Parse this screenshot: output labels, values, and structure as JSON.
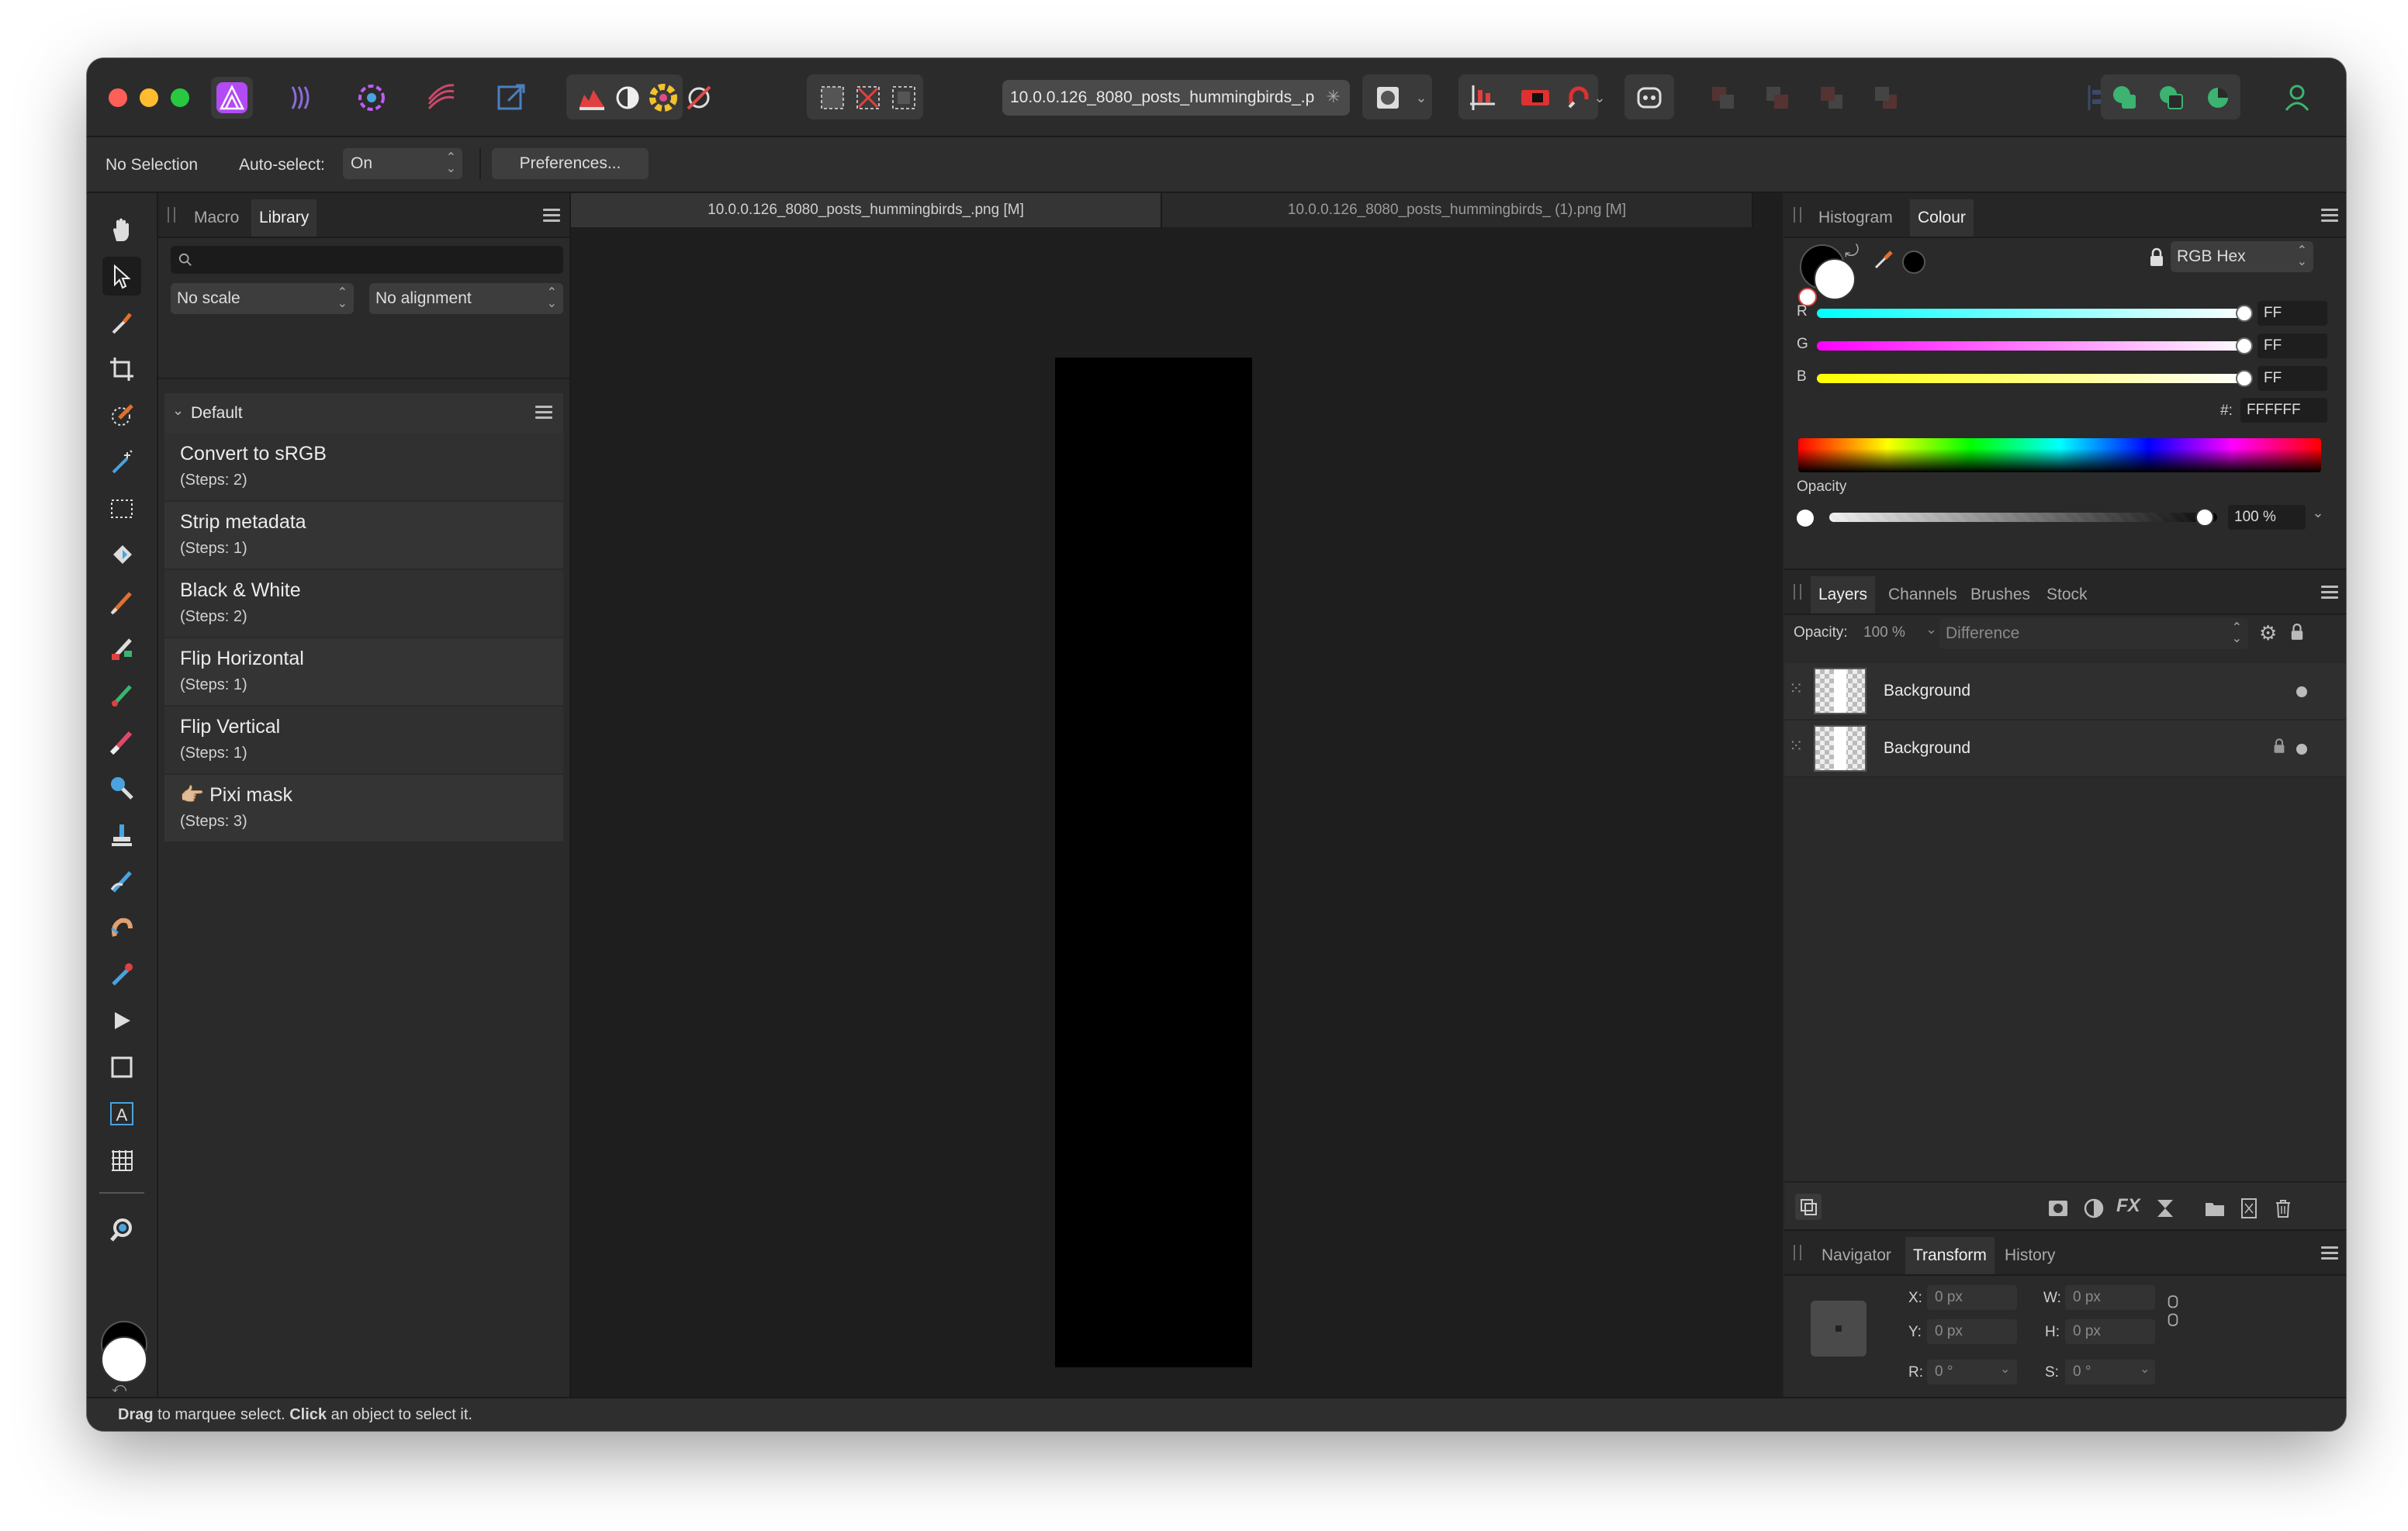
{
  "document_tab_title": "10.0.0.126_8080_posts_hummingbirds_.p",
  "context_toolbar": {
    "selection_status": "No Selection",
    "auto_select_label": "Auto-select:",
    "auto_select_value": "On",
    "preferences_button": "Preferences..."
  },
  "left_panel": {
    "tabs": [
      "Macro",
      "Library"
    ],
    "active_tab": "Library",
    "scale_select": "No scale",
    "alignment_select": "No alignment",
    "group_name": "Default",
    "macros": [
      {
        "name": "Convert to sRGB",
        "steps": "(Steps: 2)"
      },
      {
        "name": "Strip metadata",
        "steps": "(Steps: 1)"
      },
      {
        "name": "Black & White",
        "steps": "(Steps: 2)"
      },
      {
        "name": "Flip Horizontal",
        "steps": "(Steps: 1)"
      },
      {
        "name": "Flip Vertical",
        "steps": "(Steps: 1)"
      },
      {
        "name": "Pixi mask",
        "steps": "(Steps: 3)",
        "emoji": "👉🏼"
      }
    ]
  },
  "document_tabs": [
    {
      "title": "10.0.0.126_8080_posts_hummingbirds_.png [M]",
      "active": true
    },
    {
      "title": "10.0.0.126_8080_posts_hummingbirds_ (1).png [M]",
      "active": false
    }
  ],
  "colour_panel": {
    "tabs": [
      "Histogram",
      "Colour"
    ],
    "active_tab": "Colour",
    "mode": "RGB Hex",
    "channels": [
      {
        "label": "R",
        "value": "FF",
        "level": 1.0
      },
      {
        "label": "G",
        "value": "FF",
        "level": 1.0
      },
      {
        "label": "B",
        "value": "FF",
        "level": 1.0
      }
    ],
    "hex_label": "#:",
    "hex_value": "FFFFFF",
    "opacity_label": "Opacity",
    "opacity_value": "100 %"
  },
  "layers_panel": {
    "tabs": [
      "Layers",
      "Channels",
      "Brushes",
      "Stock"
    ],
    "active_tab": "Layers",
    "opacity_label": "Opacity:",
    "opacity_value": "100 %",
    "blend_mode": "Difference",
    "layers": [
      {
        "name": "Background",
        "locked": false
      },
      {
        "name": "Background",
        "locked": true
      }
    ]
  },
  "transform_panel": {
    "tabs": [
      "Navigator",
      "Transform",
      "History"
    ],
    "active_tab": "Transform",
    "x_label": "X:",
    "x_value": "0 px",
    "y_label": "Y:",
    "y_value": "0 px",
    "w_label": "W:",
    "w_value": "0 px",
    "h_label": "H:",
    "h_value": "0 px",
    "r_label": "R:",
    "r_value": "0 °",
    "s_label": "S:",
    "s_value": "0 °"
  },
  "status_bar": {
    "part1": "Drag",
    "part2": " to marquee select. ",
    "part3": "Click",
    "part4": " an object to select it."
  },
  "colors": {
    "accent_purple": "#b24bf3",
    "active_tab_bg": "#353535",
    "panel_bg": "#2a2a2a"
  }
}
